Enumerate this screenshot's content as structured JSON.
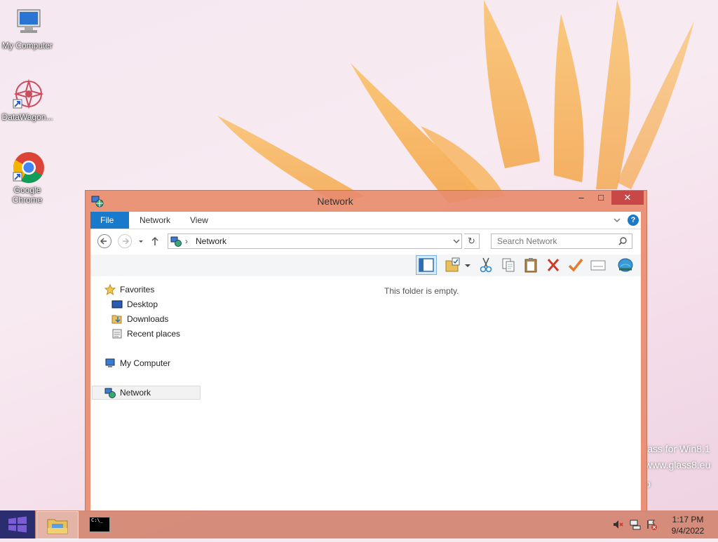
{
  "desktop": {
    "icons": [
      {
        "label": "My Computer"
      },
      {
        "label": "DataWagon..."
      },
      {
        "label": "Google Chrome"
      }
    ],
    "watermark": {
      "line1": "lass for Win8.1",
      "line2": "www.glass8.eu",
      "line3": "o"
    }
  },
  "window": {
    "title": "Network",
    "controls": {
      "minimize": "–",
      "maximize": "□",
      "close": "✕"
    },
    "ribbon": {
      "tabs": [
        "File",
        "Network",
        "View"
      ],
      "active_tab": "File",
      "collapse_icon": "chevron-down-icon",
      "help_label": "?"
    },
    "address": {
      "location": "Network",
      "separator": "›",
      "refresh": "↻"
    },
    "search": {
      "placeholder": "Search Network"
    },
    "toolbar": {
      "items": [
        "preview-pane",
        "folder-options",
        "cut",
        "copy",
        "paste",
        "delete",
        "checkmark",
        "properties",
        "network"
      ]
    },
    "nav_pane": {
      "favorites": "Favorites",
      "items": [
        "Desktop",
        "Downloads",
        "Recent places"
      ],
      "my_computer": "My Computer",
      "network": "Network"
    },
    "content": {
      "empty_message": "This folder is empty."
    }
  },
  "taskbar": {
    "clock": {
      "time": "1:17 PM",
      "date": "9/4/2022"
    },
    "cmd_label": "C:\\_"
  },
  "colors": {
    "accent": "#1979ca",
    "window_frame": "#e88c6e",
    "close_button": "#c84848"
  }
}
